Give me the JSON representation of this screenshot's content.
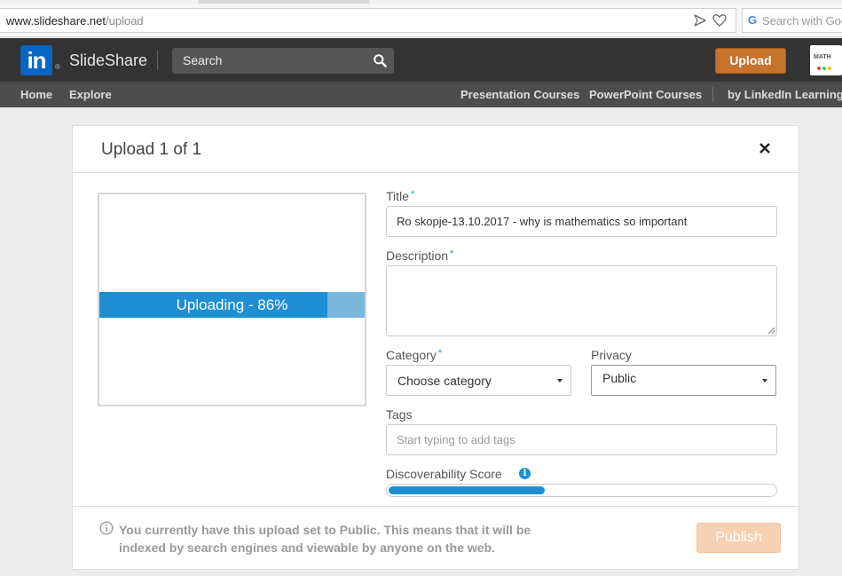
{
  "browser": {
    "url_host": "www.slideshare.net",
    "url_path": "/upload",
    "search_placeholder": "Search with Goo"
  },
  "header": {
    "logo_text": "in",
    "brand": "SlideShare",
    "search_placeholder": "Search",
    "upload_label": "Upload",
    "avatar_text": "MATH"
  },
  "subnav": {
    "home": "Home",
    "explore": "Explore",
    "presentation_courses": "Presentation Courses",
    "powerpoint_courses": "PowerPoint Courses",
    "linkedin_learning": "by LinkedIn Learning"
  },
  "modal": {
    "title": "Upload 1 of 1",
    "progress": {
      "label": "Uploading - 86%",
      "percent": 86
    },
    "title_field": {
      "label": "Title",
      "required_mark": "*",
      "value": "Ro skopje-13.10.2017 - why is mathematics so important"
    },
    "description_field": {
      "label": "Description",
      "required_mark": "*",
      "value": ""
    },
    "category_field": {
      "label": "Category",
      "required_mark": "*",
      "value": "Choose category"
    },
    "privacy_field": {
      "label": "Privacy",
      "value": "Public"
    },
    "tags_field": {
      "label": "Tags",
      "placeholder": "Start typing to add tags"
    },
    "discoverability": {
      "label": "Discoverability Score",
      "info_glyph": "i",
      "score_fraction": 0.4
    },
    "footer_notice": "You currently have this upload set to Public. This means that it will be indexed by search engines and viewable by anyone on the web.",
    "publish_label": "Publish"
  },
  "colors": {
    "accent_blue": "#1e8fd2",
    "upload_orange": "#c5722a",
    "publish_disabled": "#f6d1b3",
    "header_bg": "#333333"
  }
}
